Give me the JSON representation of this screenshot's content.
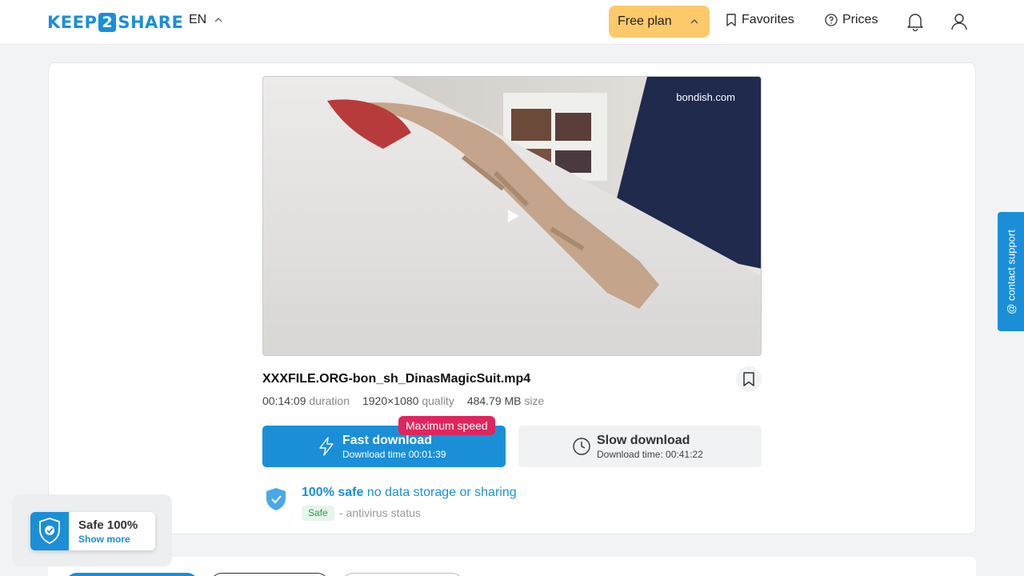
{
  "header": {
    "logo": {
      "left": "KEEP",
      "middle": "2",
      "right": "SHARE"
    },
    "language": "EN",
    "plan_label": "Free plan",
    "favorites_label": "Favorites",
    "prices_label": "Prices"
  },
  "preview": {
    "watermark": "bondish.com"
  },
  "file": {
    "name": "XXXFILE.ORG-bon_sh_DinasMagicSuit.mp4",
    "duration_value": "00:14:09",
    "duration_label": "duration",
    "quality_value": "1920×1080",
    "quality_label": "quality",
    "size_value": "484.79 MB",
    "size_label": "size"
  },
  "download": {
    "fast_title": "Fast download",
    "fast_time": "Download time 00:01:39",
    "fast_badge": "Maximum speed",
    "slow_title": "Slow download",
    "slow_time": "Download time: 00:41:22"
  },
  "safety": {
    "headline_bold": "100% safe",
    "headline_rest": "no data storage or sharing",
    "tag": "Safe",
    "status_text": "- antivirus status"
  },
  "support_tab": "@ contact support",
  "safe_widget": {
    "title": "Safe 100%",
    "link": "Show more"
  },
  "colors": {
    "accent": "#1a8fd8",
    "plan": "#fcc96b",
    "badge": "#e0245e",
    "safe_green": "#2e9a4e"
  }
}
